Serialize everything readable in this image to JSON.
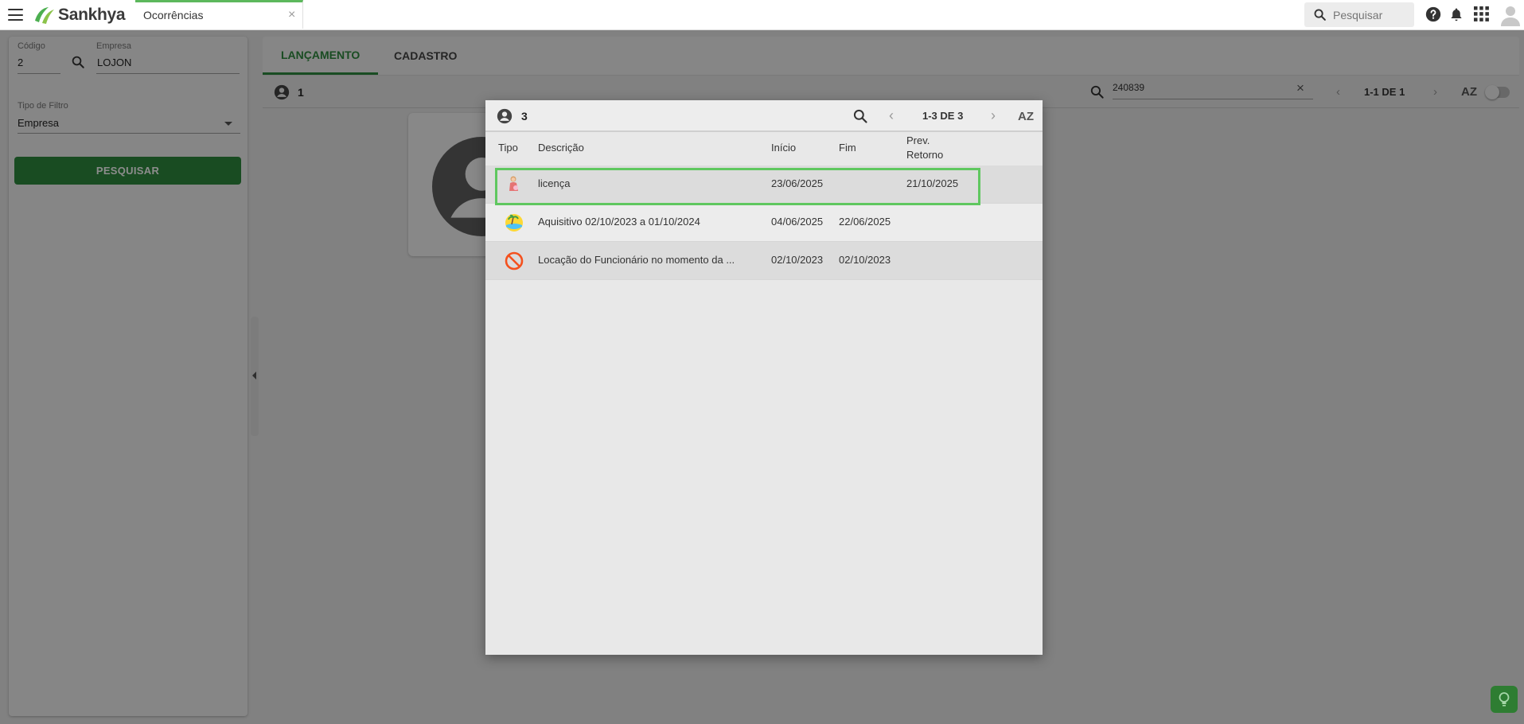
{
  "topbar": {
    "brand": "Sankhya",
    "tab_title": "Ocorrências",
    "tab_close": "×",
    "search_placeholder": "Pesquisar"
  },
  "filter_panel": {
    "codigo_label": "Código",
    "codigo_value": "2",
    "empresa_label": "Empresa",
    "empresa_value": "LOJON",
    "tipo_filtro_label": "Tipo de Filtro",
    "tipo_filtro_value": "Empresa",
    "search_button": "PESQUISAR"
  },
  "main": {
    "tabs": [
      {
        "label": "LANÇAMENTO",
        "active": true
      },
      {
        "label": "CADASTRO",
        "active": false
      }
    ],
    "record_count": "1",
    "search_value": "240839",
    "search_clear": "×",
    "pager": "1-1 DE 1"
  },
  "modal": {
    "count": "3",
    "pager": "1-3 DE 3",
    "sort_label": "AZ",
    "columns": {
      "tipo": "Tipo",
      "descricao": "Descrição",
      "inicio": "Início",
      "fim": "Fim",
      "prev_retorno_1": "Prev.",
      "prev_retorno_2": "Retorno"
    },
    "rows": [
      {
        "icon": "maternity-icon",
        "descricao": "licença",
        "inicio": "23/06/2025",
        "fim": "",
        "prev_retorno": "21/10/2025",
        "selected": true
      },
      {
        "icon": "vacation-beach-icon",
        "descricao": "Aquisitivo 02/10/2023 a 01/10/2024",
        "inicio": "04/06/2025",
        "fim": "22/06/2025",
        "prev_retorno": ""
      },
      {
        "icon": "prohibited-icon",
        "descricao": "Locação do Funcionário no momento da ...",
        "inicio": "02/10/2023",
        "fim": "02/10/2023",
        "prev_retorno": ""
      }
    ]
  },
  "colors": {
    "accent_green": "#2e8b3e",
    "highlight_green": "#5fc75f",
    "tab_underline": "#5cb85c"
  }
}
